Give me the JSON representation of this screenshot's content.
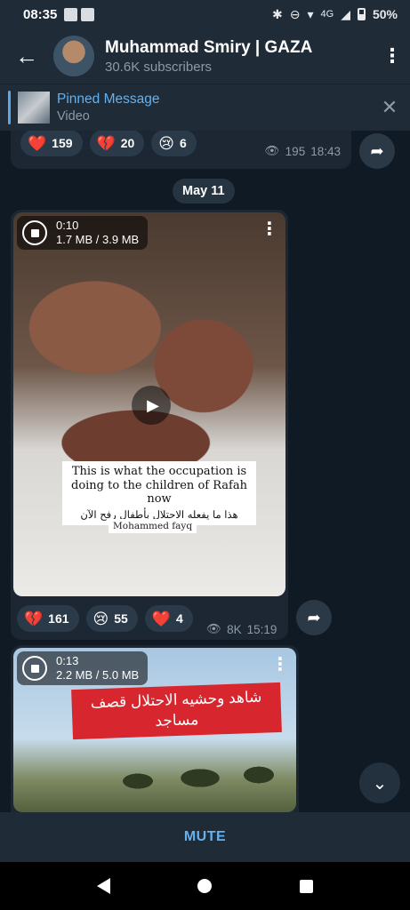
{
  "status_bar": {
    "time": "08:35",
    "network": "4G",
    "battery": "50%"
  },
  "header": {
    "back_icon": "arrow-left-icon",
    "channel_name": "Muhammad Smiry | GAZA",
    "subscribers": "30.6K subscribers",
    "menu_icon": "more-vert-icon"
  },
  "pinned": {
    "title": "Pinned Message",
    "subtitle": "Video",
    "close_icon": "close-icon"
  },
  "messages": [
    {
      "reactions": [
        {
          "emoji": "❤️",
          "icon": "red-heart-icon",
          "count": "159"
        },
        {
          "emoji": "💔",
          "icon": "broken-heart-icon",
          "count": "20"
        },
        {
          "emoji": "😢",
          "icon": "crying-face-icon",
          "count": "6"
        }
      ],
      "views": "195",
      "time": "18:43"
    },
    {
      "date": "May 11",
      "video": {
        "duration": "0:10",
        "size": "1.7 MB / 3.9 MB",
        "caption_en": "This is what the occupation is doing to the children of Rafah now",
        "caption_ar": "هذا ما يفعله الاحتلال بأطفال رفح الآن",
        "watermark": "Mohammed fayq"
      },
      "reactions": [
        {
          "emoji": "💔",
          "icon": "broken-heart-icon",
          "count": "161"
        },
        {
          "emoji": "😢",
          "icon": "crying-face-icon",
          "count": "55"
        },
        {
          "emoji": "❤️",
          "icon": "red-heart-icon",
          "count": "4"
        }
      ],
      "views": "8K",
      "time": "15:19"
    },
    {
      "video": {
        "duration": "0:13",
        "size": "2.2 MB / 5.0 MB",
        "banner_ar": "شاهد وحشيه الاحتلال قصف مساجد"
      }
    }
  ],
  "bottom": {
    "mute_label": "MUTE"
  }
}
